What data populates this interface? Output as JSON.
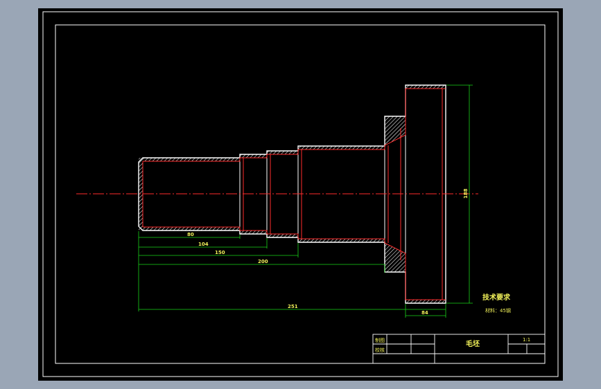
{
  "colors": {
    "background": "#9aa6b6",
    "sheet": "#000000",
    "frame": "#ffffff",
    "outline": "#ffffff",
    "hatch": "#ffffff",
    "hidden_line": "#ff2d2d",
    "centerline": "#ff2d2d",
    "dimension": "#19d419",
    "text": "#f2f25a"
  },
  "dimensions": {
    "d1": "80",
    "d2": "104",
    "d3": "150",
    "d4": "200",
    "d5": "251",
    "d6": "84",
    "d7": "188"
  },
  "notes": {
    "heading": "技术要求",
    "material": "材料：45钢"
  },
  "title_block": {
    "part_name": "毛坯",
    "scale": "1:1",
    "drawn_label": "制图",
    "checked_label": "校核"
  }
}
